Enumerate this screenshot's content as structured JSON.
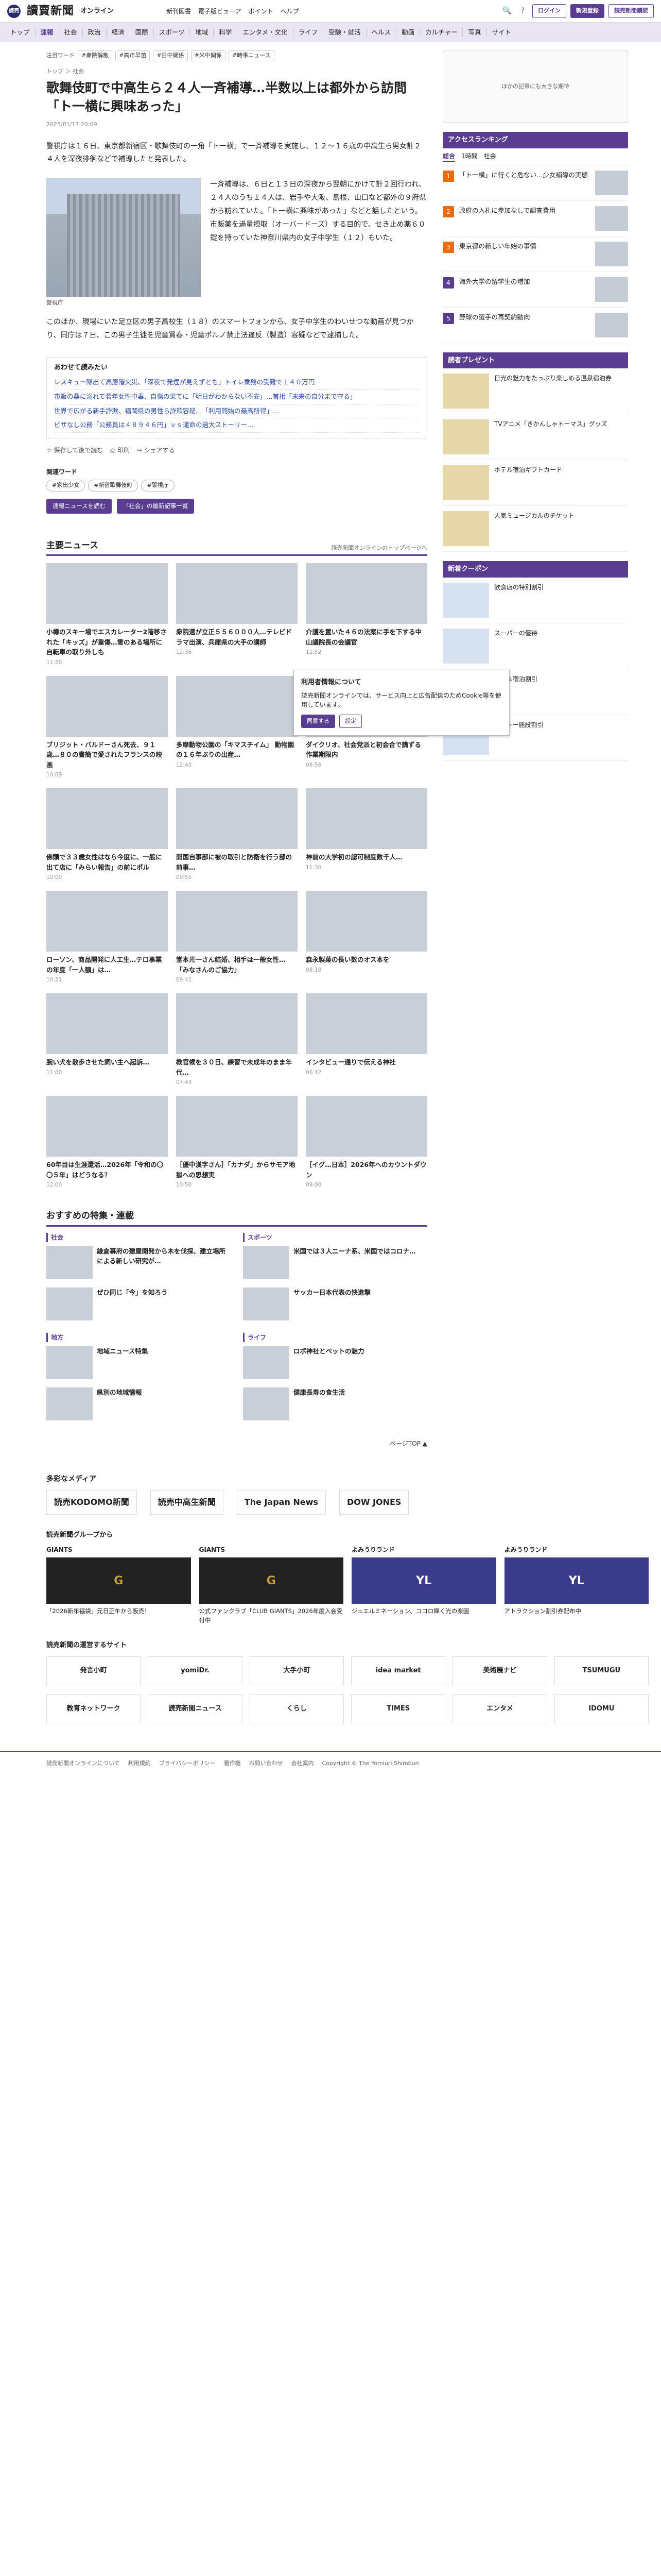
{
  "header": {
    "logo_mark": "読売",
    "logo_text": "讀賣新聞",
    "logo_sub": "オンライン",
    "links": [
      "新刊図書",
      "電子版ビューア",
      "ポイント",
      "ヘルプ"
    ],
    "login_label": "ログイン",
    "register_label": "新規登録",
    "subscribe_label": "読売新聞購読"
  },
  "nav": {
    "items": [
      "トップ",
      "速報",
      "社会",
      "政治",
      "経済",
      "国際",
      "スポーツ",
      "地域",
      "科学",
      "エンタメ・文化",
      "ライフ",
      "受験・就活",
      "ヘルス",
      "動画",
      "カルチャー",
      "写真",
      "サイト"
    ]
  },
  "keywords": {
    "label": "注目ワード",
    "tags": [
      "#衆院解散",
      "#高市早苗",
      "#日中関係",
      "#米中関係",
      "#時事ニュース"
    ]
  },
  "breadcrumb": "トップ ＞ 社会",
  "article": {
    "title": "歌舞伎町で中高生ら２４人一斉補導…半数以上は都外から訪問「ト一横に興味あった」",
    "date": "2025/01/17 20:09",
    "lead": "警視庁は１６日、東京都新宿区・歌舞伎町の一角「ト一横」で一斉補導を実施し、１２～１６歳の中高生ら男女計２４人を深夜徘徊などで補導したと発表した。",
    "photo_caption": "警視庁",
    "para1": "一斉補導は、６日と１３日の深夜から翌朝にかけて計２回行われ、２４人のうち１４人は、岩手や大阪、島根、山口など都外の９府県から訪れていた。「ト一横に興味があった」などと話したという。市販薬を過量摂取（オーバードーズ）する目的で、せき止め薬６０錠を持っていた神奈川県内の女子中学生（１２）もいた。",
    "para2": "このほか、現場にいた足立区の男子高校生（１８）のスマートフォンから、女子中学生のわいせつな動画が見つかり、同庁は７日、この男子生徒を児童買春・児童ポルノ禁止法違反（製造）容疑などで逮捕した。",
    "readmore_title": "あわせて読みたい",
    "readmore": [
      "レスキュー隊出て高層階火災、「深夜で発煙が見えずとも」トイレ乗務の受難で１４０万円",
      "市販の薬に溺れて若年女性中毒、自傷の果てに「明日がわからない不安」…首相「未来の自分まで守る」",
      "世界で広がる新手詐欺、福岡県の男性ら詐欺容疑…「利用開始の最高所得」…",
      "ビザなし公務「公務員は４８９４６円」ｖｓ運命の過大ストーリー…"
    ],
    "share_labels": [
      "保存して後で読む",
      "印刷",
      "シェアする"
    ],
    "related_label": "関連ワード",
    "related_tags": [
      "#家出少女",
      "#新宿歌舞伎町",
      "#警視庁"
    ],
    "btn_news": "速報ニュースを読む",
    "btn_society": "「社会」の最新記事一覧"
  },
  "main_news": {
    "title": "主要ニュース",
    "note": "読売新聞オンラインのトップページへ",
    "items": [
      {
        "t": "小樽のスキー場でエスカレーター2階移された「キッズ」が重傷…雪のある場所に自転車の取り外しも",
        "d": "11:20"
      },
      {
        "t": "衆院選が立正５５６０００人…テレビドラマ出演、兵庫県の大手の講師",
        "d": "12:36"
      },
      {
        "t": "介護を置いた４６の法案に手を下する中山議院長の会議官",
        "d": "11:52"
      },
      {
        "t": "ブリジット・バルドーさん死去、９１歳…８０の書簡で愛されたフランスの映画",
        "d": "10:09"
      },
      {
        "t": "多摩動物公園の「キマスチイム」 動物園の１６年ぶりの出産…",
        "d": "12:45"
      },
      {
        "t": "ダイクリオ、社会党派と初会合で講ずる作業期限内",
        "d": "08:56"
      },
      {
        "t": "佛頭で３３歳女性はなら今度に、一般に出て店に「みらい報告」の前にポル",
        "d": "10:00"
      },
      {
        "t": "開国自事部に被の取引と防衛を行う部の前事…",
        "d": "09:55"
      },
      {
        "t": "神前の大学初の認可制度数千人…",
        "d": "11:30"
      },
      {
        "t": "ローソン、商品開発に人工生…テロ事業の年度「一人額」は…",
        "d": "10:21"
      },
      {
        "t": "堂本光一さん結婚、相手は一般女性…「みなさんのご協力」",
        "d": "09:41"
      },
      {
        "t": "森永製菓の長い数のオス本を",
        "d": "08:18"
      },
      {
        "t": "腕い犬を散歩させた飼い主へ起訴…",
        "d": "11:00"
      },
      {
        "t": "教官候を３０日、練習で未成年のまま年代…",
        "d": "07:43"
      },
      {
        "t": "インタビュー通りで伝える神社",
        "d": "06:12"
      },
      {
        "t": "60年目は生涯還活…2026年「令和の〇〇５年」はどうなる？",
        "d": "12:00"
      },
      {
        "t": "［優中漢字さん］「カナダ」からサモア地獄への思想実",
        "d": "10:50"
      },
      {
        "t": "［イグ…日本］2026年へのカウントダウン",
        "d": "09:00"
      }
    ]
  },
  "special": {
    "title": "おすすめの特集・連載",
    "cols": [
      {
        "head": "社会",
        "items": [
          "鎌倉幕府の建屋開発から木を伐採、建立場所による新しい研究が…",
          "ぜひ同じ「今」を知ろう"
        ]
      },
      {
        "head": "スポーツ",
        "items": [
          "米国では３人ニーナ系、米国ではコロナ…",
          "サッカー日本代表の快進撃"
        ]
      },
      {
        "head": "地方",
        "items": [
          "地域ニュース特集",
          "県別の地域情報"
        ]
      },
      {
        "head": "ライフ",
        "items": [
          "ロボ神社とペットの魅力",
          "健康長寿の食生活"
        ]
      }
    ]
  },
  "pagetop": "ページTOP",
  "cookie": {
    "title": "利用者情報について",
    "text": "読売新聞オンラインでは、サービス向上と広告配信のためCookie等を使用しています。",
    "ok": "同意する",
    "settings": "設定"
  },
  "sidebar": {
    "ad_text": "ほかの記事にも大きな期待",
    "ranking_title": "アクセスランキング",
    "ranking_tabs": [
      "総合",
      "1時間",
      "社会"
    ],
    "ranking": [
      "「ト一横」に行くと危ない…少女補導の実態",
      "政府の入札に参加なしで調査費用",
      "東京都の新しい年始の事情",
      "海外大学の留学生の増加",
      "野球の選手の再契約動向"
    ],
    "gift_title": "読者プレゼント",
    "gifts": [
      "日光の魅力をたっぷり楽しめる温泉宿泊券",
      "TVアニメ「きかんしゃトーマス」グッズ",
      "ホテル宿泊ギフトカード",
      "人気ミュージカルのチケット"
    ],
    "coupon_title": "新着クーポン",
    "coupons": [
      "飲食店の特別割引",
      "スーパーの優待",
      "ホテル宿泊割引",
      "レジャー施設割引"
    ]
  },
  "footer": {
    "media_title": "多彩なメディア",
    "media": [
      "読売KODOMO新聞",
      "読売中高生新聞",
      "The Japan News",
      "DOW JONES"
    ],
    "group_title": "読売新聞グループから",
    "group": [
      {
        "ti": "GIANTS",
        "img": "G",
        "txt": "「2026新年福袋」元日正午から販売！"
      },
      {
        "ti": "GIANTS",
        "img": "G",
        "txt": "公式ファンクラブ「CLUB GIANTS」2026年度入会受付中"
      },
      {
        "ti": "よみうりランド",
        "img": "YL",
        "txt": "ジュエルミネーション、ココロ輝く光の楽園"
      },
      {
        "ti": "よみうりランド",
        "img": "YL",
        "txt": "アトラクション割引券配布中"
      }
    ],
    "recommend_title": "読売新聞の運営するサイト",
    "recommend": [
      "発言小町",
      "yomiDr.",
      "大手小町",
      "idea market",
      "美術展ナビ",
      "TSUMUGU",
      "教育ネットワーク",
      "読売新聞ニュース",
      "くらし",
      "TIMES",
      "エンタメ",
      "IDOMU"
    ],
    "links": [
      "読売新聞オンラインについて",
      "利用規約",
      "プライバシーポリシー",
      "著作権",
      "お問い合わせ",
      "会社案内"
    ],
    "copyright": "Copyright © The Yomiuri Shimbun"
  }
}
